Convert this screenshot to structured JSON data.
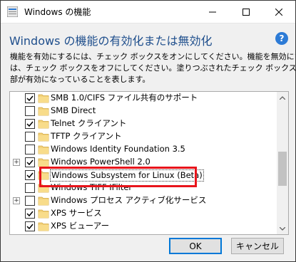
{
  "window": {
    "title": "Windows の機能",
    "heading": "Windows の機能の有効化または無効化",
    "help": "?",
    "description_lines": [
      "機能を有効にするには、チェック ボックスをオンにしてください。機能を無効にするに",
      "は、チェック ボックスをオフにしてください。塗りつぶされたチェック ボックスは、機能の一",
      "部が有効になっていることを表します。"
    ]
  },
  "features": [
    {
      "label": "SMB 1.0/CIFS ファイル共有のサポート",
      "checked": true,
      "expandable": false
    },
    {
      "label": "SMB Direct",
      "checked": false,
      "expandable": false
    },
    {
      "label": "Telnet クライアント",
      "checked": true,
      "expandable": false
    },
    {
      "label": "TFTP クライアント",
      "checked": false,
      "expandable": false
    },
    {
      "label": "Windows Identity Foundation 3.5",
      "checked": false,
      "expandable": false
    },
    {
      "label": "Windows PowerShell 2.0",
      "checked": true,
      "expandable": true
    },
    {
      "label": "Windows Subsystem for Linux (Beta)",
      "checked": true,
      "expandable": false,
      "selected": true
    },
    {
      "label": "Windows TIFF IFilter",
      "checked": false,
      "expandable": false
    },
    {
      "label": "Windows プロセス アクティブ化サービス",
      "checked": false,
      "expandable": true
    },
    {
      "label": "XPS サービス",
      "checked": true,
      "expandable": false
    },
    {
      "label": "XPS ビューアー",
      "checked": true,
      "expandable": false
    }
  ],
  "buttons": {
    "ok": "OK",
    "cancel": "キャンセル"
  },
  "colors": {
    "accent": "#0078d7",
    "heading": "#1e4e8c",
    "highlight": "#e8141b"
  }
}
